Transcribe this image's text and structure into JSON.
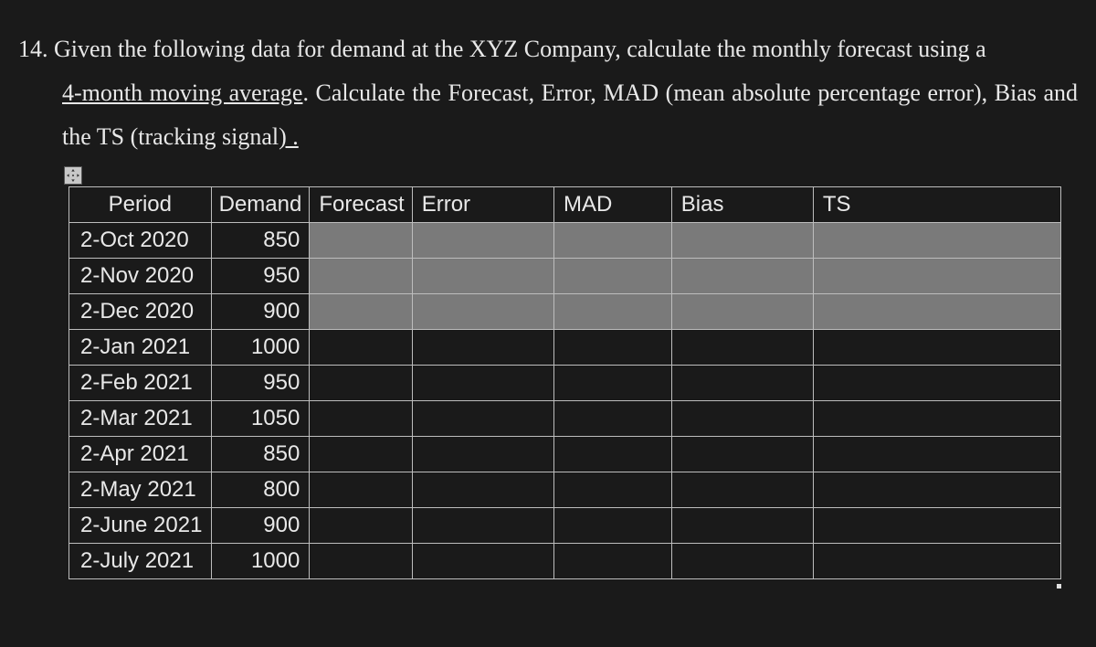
{
  "question": {
    "number": "14.",
    "text_part1": "Given the following data for demand at the XYZ Company, calculate the monthly forecast using a ",
    "underlined1": "4-month moving average",
    "text_part2": ". Calculate the Forecast, Error, MAD (mean absolute percentage error), Bias and the TS (tracking signal",
    "underlined2": ") .",
    "text_part3": ""
  },
  "table": {
    "headers": {
      "period": "Period",
      "demand": "Demand",
      "forecast": "Forecast",
      "error": "Error",
      "mad": "MAD",
      "bias": "Bias",
      "ts": "TS"
    },
    "rows": [
      {
        "period": "2-Oct 2020",
        "demand": "850",
        "greyed": true
      },
      {
        "period": "2-Nov 2020",
        "demand": "950",
        "greyed": true
      },
      {
        "period": "2-Dec 2020",
        "demand": "900",
        "greyed": true
      },
      {
        "period": "2-Jan 2021",
        "demand": "1000",
        "greyed": false
      },
      {
        "period": "2-Feb 2021",
        "demand": "950",
        "greyed": false
      },
      {
        "period": "2-Mar 2021",
        "demand": "1050",
        "greyed": false
      },
      {
        "period": "2-Apr 2021",
        "demand": "850",
        "greyed": false
      },
      {
        "period": "2-May 2021",
        "demand": "800",
        "greyed": false
      },
      {
        "period": "2-June 2021",
        "demand": "900",
        "greyed": false
      },
      {
        "period": "2-July 2021",
        "demand": "1000",
        "greyed": false
      }
    ]
  },
  "chart_data": {
    "type": "table",
    "columns": [
      "Period",
      "Demand",
      "Forecast",
      "Error",
      "MAD",
      "Bias",
      "TS"
    ],
    "rows": [
      [
        "2-Oct 2020",
        850,
        null,
        null,
        null,
        null,
        null
      ],
      [
        "2-Nov 2020",
        950,
        null,
        null,
        null,
        null,
        null
      ],
      [
        "2-Dec 2020",
        900,
        null,
        null,
        null,
        null,
        null
      ],
      [
        "2-Jan 2021",
        1000,
        null,
        null,
        null,
        null,
        null
      ],
      [
        "2-Feb 2021",
        950,
        null,
        null,
        null,
        null,
        null
      ],
      [
        "2-Mar 2021",
        1050,
        null,
        null,
        null,
        null,
        null
      ],
      [
        "2-Apr 2021",
        850,
        null,
        null,
        null,
        null,
        null
      ],
      [
        "2-May 2021",
        800,
        null,
        null,
        null,
        null,
        null
      ],
      [
        "2-June 2021",
        900,
        null,
        null,
        null,
        null,
        null
      ],
      [
        "2-July 2021",
        1000,
        null,
        null,
        null,
        null,
        null
      ]
    ]
  }
}
